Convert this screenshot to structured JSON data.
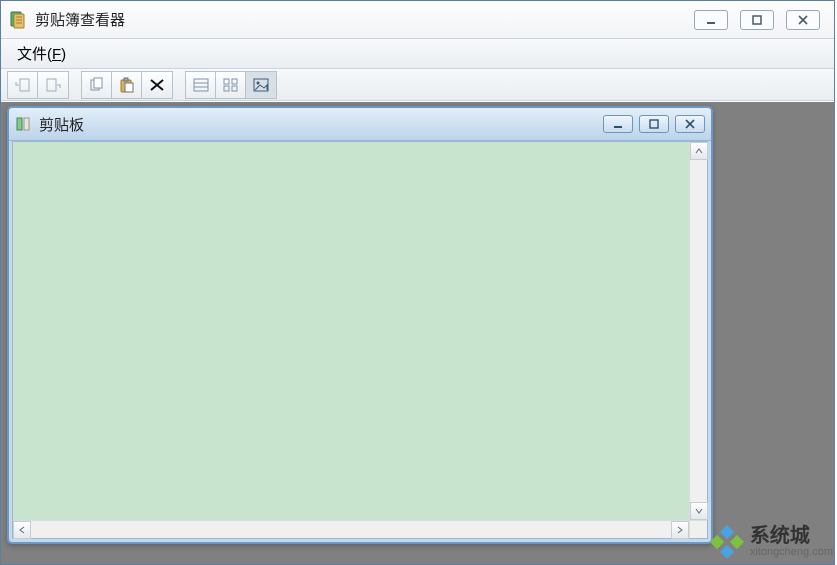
{
  "app": {
    "title": "剪贴簿查看器"
  },
  "menu": {
    "file_label": "文件(",
    "file_hotkey": "F",
    "file_after": ")"
  },
  "toolbar": {
    "buttons": [
      {
        "name": "page-prev-icon"
      },
      {
        "name": "page-next-icon"
      },
      {
        "name": "copy-icon"
      },
      {
        "name": "paste-icon"
      },
      {
        "name": "delete-icon"
      },
      {
        "name": "view-list-icon"
      },
      {
        "name": "view-grid-icon"
      },
      {
        "name": "view-image-icon",
        "active": true
      }
    ]
  },
  "child": {
    "title": "剪贴板"
  },
  "watermark": {
    "cn": "系统城",
    "en": "xitongcheng.com"
  }
}
